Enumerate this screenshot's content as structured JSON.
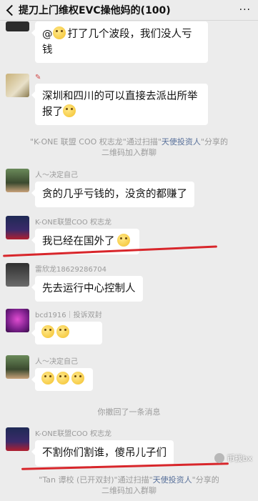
{
  "header": {
    "title": "提刀上门维权EVC操他妈的(100)",
    "more": "···"
  },
  "messages": [
    {
      "text": "打了几个波段，我们没人亏钱",
      "prefix": "@"
    },
    {
      "text": "深圳和四川的可以直接去派出所举报了"
    },
    {
      "sender": "人～决定自己",
      "text": "贪的几乎亏钱的，没贪的都赚了"
    },
    {
      "sender": "K-ONE联盟COO 权志龙",
      "text": "我已经在国外了"
    },
    {
      "sender": "雷欣龙18629286704",
      "text": "先去运行中心控制人"
    },
    {
      "sender": "bcd1916｜投诉双封"
    },
    {
      "sender": "人～决定自己"
    },
    {
      "sender": "K-ONE联盟COO 权志龙",
      "text": "不割你们割谁，傻吊儿子们"
    }
  ],
  "system": {
    "join1_a": "\"K-ONE 联盟 COO 权志龙\"通过扫描\"",
    "join1_b": "天使投资人",
    "join1_c": "\"分享的",
    "join1_d": "二维码加入群聊",
    "recall": "你撤回了一条消息",
    "join2_a": "\"Tan 谭校 (已开双封)\"通过扫描\"",
    "join2_b": "天使投资人",
    "join2_c": "\"分享的",
    "join2_d": "二维码加入群聊"
  },
  "watermark": {
    "text": "币找bx"
  },
  "colors": {
    "red_underline": "#d8262b",
    "link_blue": "#58709a"
  }
}
